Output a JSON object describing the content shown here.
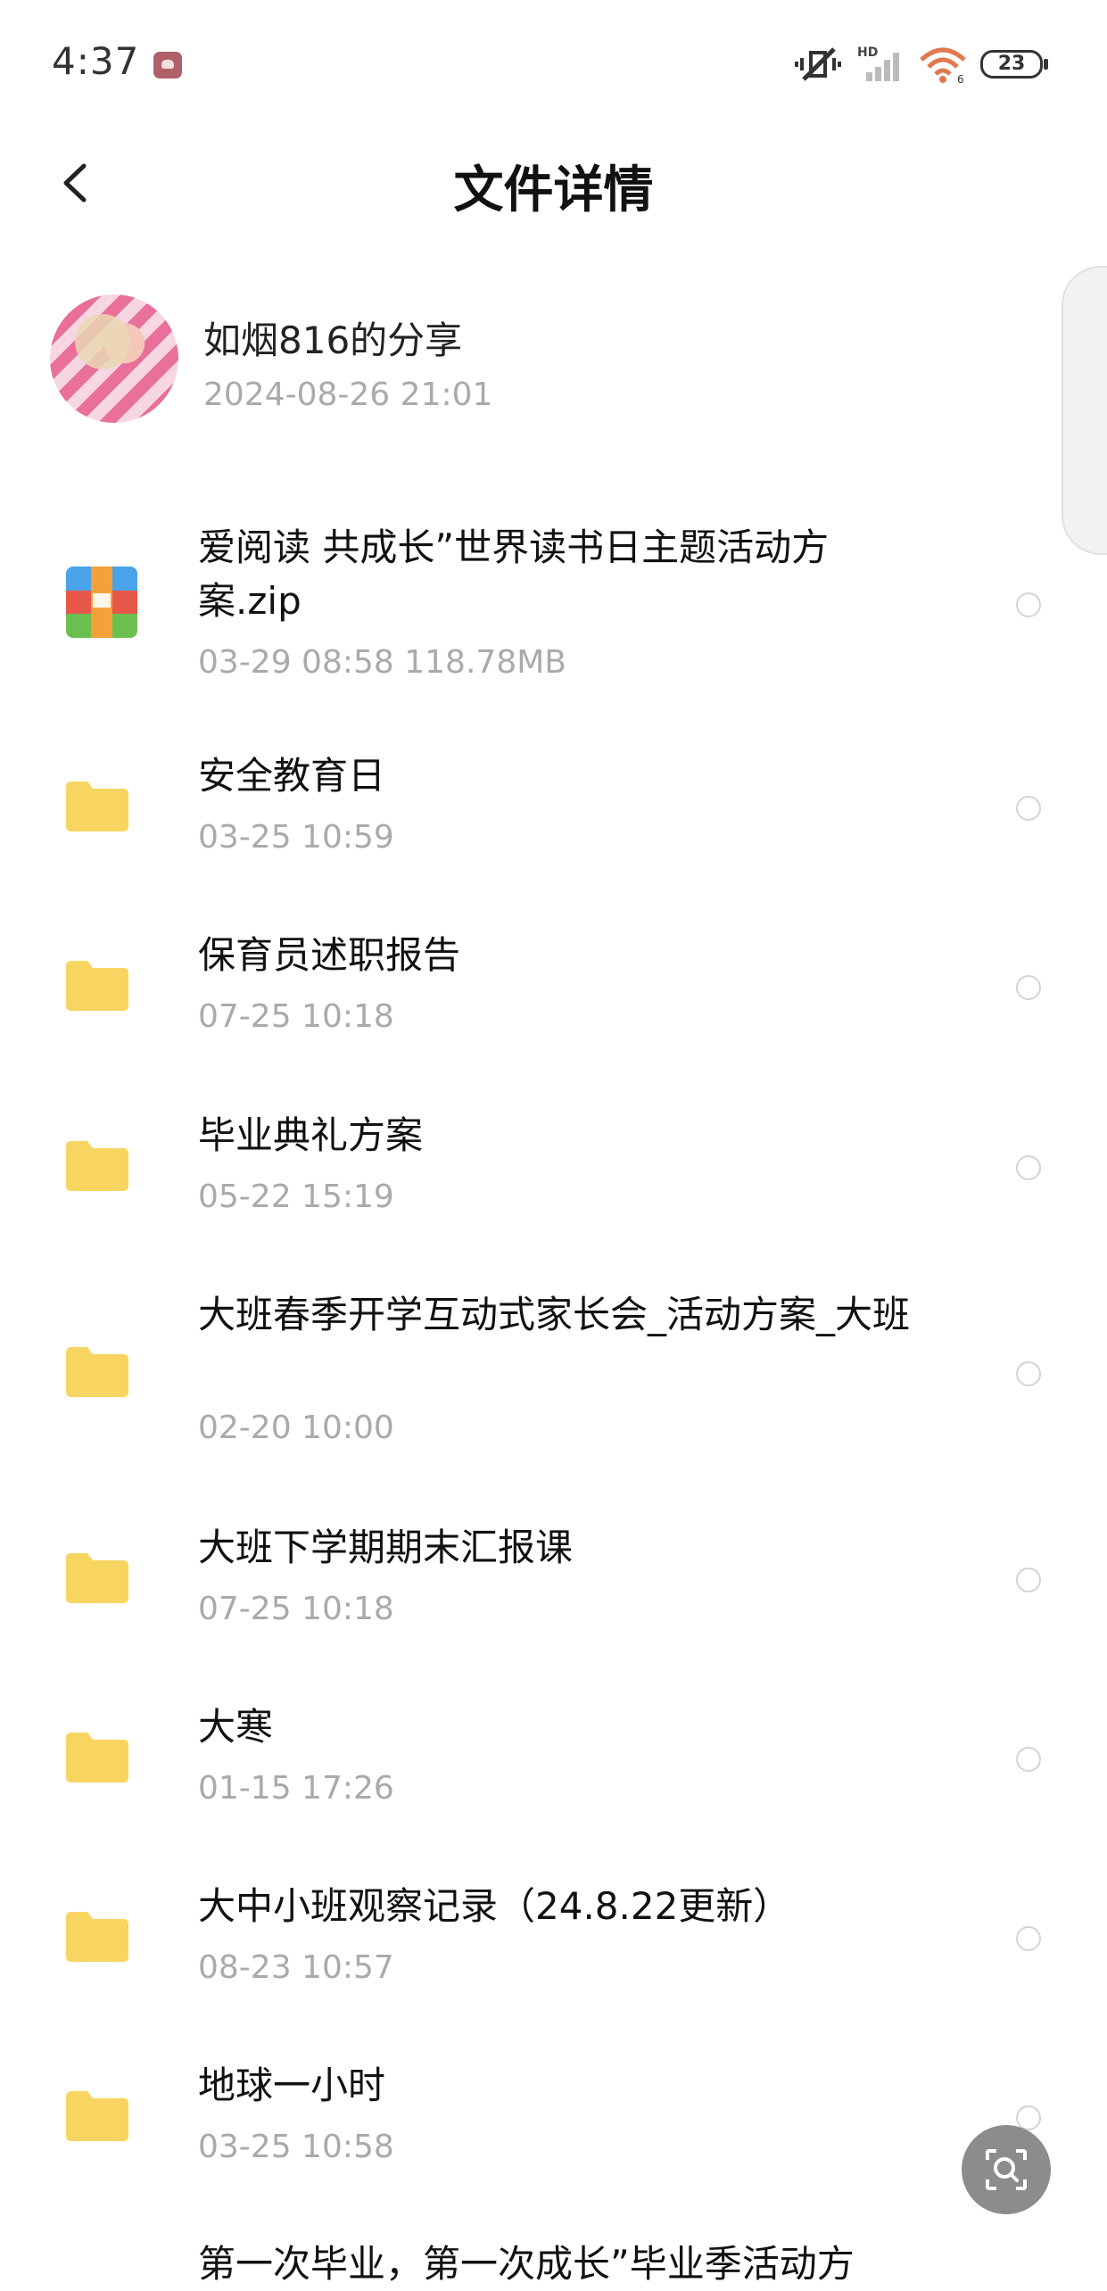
{
  "status_bar": {
    "time": "4:37",
    "battery": "23",
    "icons": [
      "cloud-notification-icon",
      "vibrate-mute-icon",
      "signal-icon",
      "wifi-icon",
      "battery-icon"
    ]
  },
  "header": {
    "title": "文件详情",
    "back_icon": "chevron-left-icon"
  },
  "sharer": {
    "name": "如烟816的分享",
    "datetime": "2024-08-26  21:01"
  },
  "colors": {
    "folder": "#f8d561",
    "meta_text": "#aaaaaa",
    "fab": "#8c8c8c"
  },
  "files": [
    {
      "type": "zip",
      "name": "爱阅读 共成长”世界读书日主题活动方案.zip",
      "meta": "03-29  08:58   118.78MB"
    },
    {
      "type": "folder",
      "name": "安全教育日",
      "meta": "03-25  10:59"
    },
    {
      "type": "folder",
      "name": "保育员述职报告",
      "meta": "07-25  10:18"
    },
    {
      "type": "folder",
      "name": "毕业典礼方案",
      "meta": "05-22  15:19"
    },
    {
      "type": "folder",
      "name": "大班春季开学互动式家长会_活动方案_大班",
      "meta": "02-20  10:00"
    },
    {
      "type": "folder",
      "name": "大班下学期期末汇报课",
      "meta": "07-25  10:18"
    },
    {
      "type": "folder",
      "name": "大寒",
      "meta": "01-15  17:26"
    },
    {
      "type": "folder",
      "name": "大中小班观察记录（24.8.22更新）",
      "meta": "08-23  10:57"
    },
    {
      "type": "folder",
      "name": "地球一小时",
      "meta": "03-25  10:58"
    },
    {
      "type": "folder",
      "name": "第一次毕业，第一次成长”毕业季活动方",
      "meta": ""
    }
  ],
  "fab_icon": "scan-search-icon"
}
